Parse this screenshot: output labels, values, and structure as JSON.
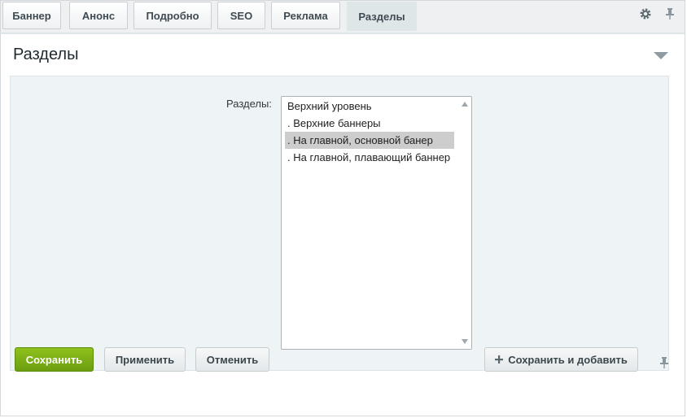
{
  "tabs": [
    {
      "label": "Баннер"
    },
    {
      "label": "Анонс"
    },
    {
      "label": "Подробно"
    },
    {
      "label": "SEO"
    },
    {
      "label": "Реклама"
    },
    {
      "label": "Разделы",
      "active": true
    }
  ],
  "panel": {
    "title": "Разделы"
  },
  "sections_field": {
    "label": "Разделы:",
    "options": [
      {
        "label": "Верхний уровень",
        "selected": false
      },
      {
        "label": ". Верхние баннеры",
        "selected": false
      },
      {
        "label": ". На главной, основной банер",
        "selected": true
      },
      {
        "label": ". На главной, плавающий баннер",
        "selected": false
      }
    ]
  },
  "footer": {
    "save_label": "Сохранить",
    "apply_label": "Применить",
    "cancel_label": "Отменить",
    "save_add_label": "Сохранить и добавить"
  },
  "icons": {
    "settings": "gear-icon",
    "pin": "pin-icon",
    "collapse": "chevron-down-icon",
    "plus": "plus-icon"
  },
  "colors": {
    "primary_button": "#7aaf16",
    "selected_option": "#cdcdcd",
    "section_background": "#eef3f5",
    "active_tab": "#dfe6e8"
  }
}
